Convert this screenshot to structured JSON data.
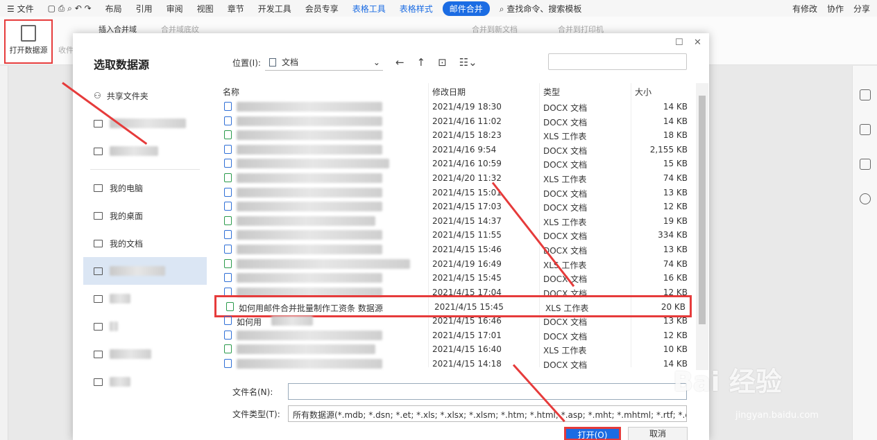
{
  "menubar": {
    "file": "文件",
    "tabs": [
      "布局",
      "引用",
      "审阅",
      "视图",
      "章节",
      "开发工具",
      "会员专享",
      "表格工具",
      "表格样式",
      "邮件合并"
    ],
    "search_placeholder": "查找命令、搜索模板",
    "right": [
      "有修改",
      "协作",
      "分享"
    ]
  },
  "toolbar": {
    "open_datasource": "打开数据源",
    "collect": "收件",
    "insert_merge_field": "插入合并域",
    "merge_field_shading": "合并域底纹",
    "merge_to_new_doc": "合并到新文档",
    "merge_to_printer": "合并到打印机"
  },
  "dialog": {
    "title": "选取数据源",
    "location_label": "位置(I):",
    "location_value": "文档",
    "sidebar": [
      "共享文件夹",
      "",
      "",
      "我的电脑",
      "我的桌面",
      "我的文档",
      "",
      "",
      "",
      "",
      ""
    ],
    "columns": {
      "name": "名称",
      "date": "修改日期",
      "type": "类型",
      "size": "大小"
    },
    "files": [
      {
        "name": "",
        "date": "2021/4/19 18:30",
        "type": "DOCX 文档",
        "size": "14 KB",
        "kind": "docx"
      },
      {
        "name": "",
        "date": "2021/4/16 11:02",
        "type": "DOCX 文档",
        "size": "14 KB",
        "kind": "docx"
      },
      {
        "name": "",
        "date": "2021/4/15 18:23",
        "type": "XLS 工作表",
        "size": "18 KB",
        "kind": "xls"
      },
      {
        "name": "",
        "date": "2021/4/16 9:54",
        "type": "DOCX 文档",
        "size": "2,155 KB",
        "kind": "docx"
      },
      {
        "name": "",
        "date": "2021/4/16 10:59",
        "type": "DOCX 文档",
        "size": "15 KB",
        "kind": "docx"
      },
      {
        "name": "",
        "date": "2021/4/20 11:32",
        "type": "XLS 工作表",
        "size": "74 KB",
        "kind": "xls"
      },
      {
        "name": "",
        "date": "2021/4/15 15:01",
        "type": "DOCX 文档",
        "size": "13 KB",
        "kind": "docx"
      },
      {
        "name": "",
        "date": "2021/4/15 17:03",
        "type": "DOCX 文档",
        "size": "12 KB",
        "kind": "docx"
      },
      {
        "name": "",
        "date": "2021/4/15 14:37",
        "type": "XLS 工作表",
        "size": "19 KB",
        "kind": "xls"
      },
      {
        "name": "",
        "date": "2021/4/15 11:55",
        "type": "DOCX 文档",
        "size": "334 KB",
        "kind": "docx"
      },
      {
        "name": "",
        "date": "2021/4/15 15:46",
        "type": "DOCX 文档",
        "size": "13 KB",
        "kind": "docx"
      },
      {
        "name": "",
        "date": "2021/4/19 16:49",
        "type": "XLS 工作表",
        "size": "74 KB",
        "kind": "xls"
      },
      {
        "name": "",
        "date": "2021/4/15 15:45",
        "type": "DOCX 文档",
        "size": "16 KB",
        "kind": "docx"
      },
      {
        "name": "",
        "date": "2021/4/15 17:04",
        "type": "DOCX 文档",
        "size": "12 KB",
        "kind": "docx"
      },
      {
        "name": "如何用邮件合并批量制作工资条 数据源",
        "date": "2021/4/15 15:45",
        "type": "XLS 工作表",
        "size": "20 KB",
        "kind": "xls",
        "selected": true
      },
      {
        "name": "如何用",
        "date": "2021/4/15 16:46",
        "type": "DOCX 文档",
        "size": "13 KB",
        "kind": "docx"
      },
      {
        "name": "",
        "date": "2021/4/15 17:01",
        "type": "DOCX 文档",
        "size": "12 KB",
        "kind": "docx"
      },
      {
        "name": "",
        "date": "2021/4/15 16:40",
        "type": "XLS 工作表",
        "size": "10 KB",
        "kind": "xls"
      },
      {
        "name": "",
        "date": "2021/4/15 14:18",
        "type": "DOCX 文档",
        "size": "14 KB",
        "kind": "docx"
      }
    ],
    "filename_label": "文件名(N):",
    "filename_value": "",
    "filetype_label": "文件类型(T):",
    "filetype_value": "所有数据源(*.mdb; *.dsn; *.et; *.xls; *.xlsx; *.xlsm; *.htm; *.html; *.asp; *.mht; *.mhtml; *.rtf; *.docx; *.doc; *.",
    "open_button": "打开(O)",
    "cancel_button": "取消"
  },
  "watermark": {
    "main": "Bai 经验",
    "sub": "jingyan.baidu.com"
  },
  "colors": {
    "accent": "#1b6ce3",
    "annotation": "#e63b3b"
  }
}
